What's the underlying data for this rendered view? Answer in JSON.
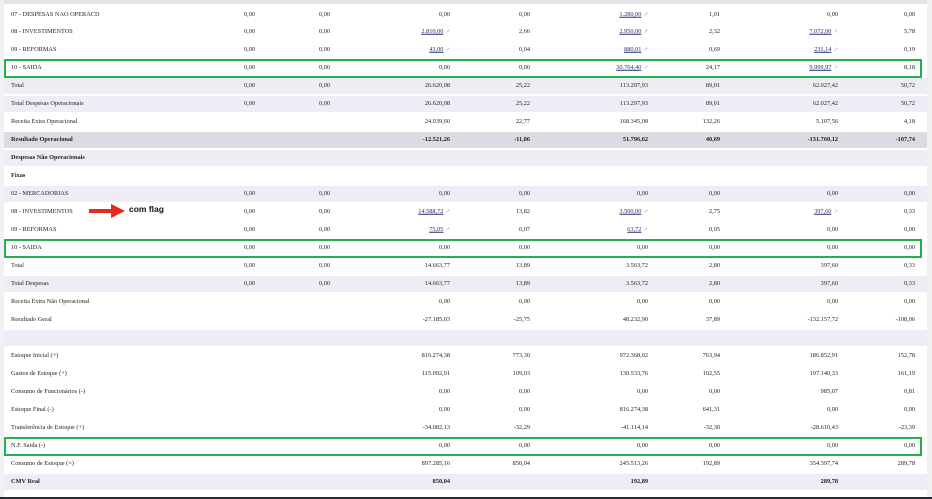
{
  "annotation": {
    "text": "com flag"
  },
  "rows": [
    {
      "label": "07 - DESPESAS NAO OPERACD",
      "c": [
        "0,00",
        "0,00",
        "0,00",
        "0,00",
        "1.280,00",
        "1,01",
        "0,00",
        "0,00"
      ],
      "links": [
        4
      ]
    },
    {
      "label": "08 - INVESTIMENTOS",
      "c": [
        "0,00",
        "0,00",
        "2.810,00",
        "2,66",
        "2.950,00",
        "2,32",
        "7.072,00",
        "5,78"
      ],
      "links": [
        2,
        4,
        6
      ]
    },
    {
      "label": "09 - REFORMAS",
      "c": [
        "0,00",
        "0,00",
        "43,00",
        "0,04",
        "880,01",
        "0,69",
        "231,14",
        "0,19"
      ],
      "links": [
        2,
        4,
        6
      ]
    },
    {
      "label": "10 - SAIDA",
      "c": [
        "0,00",
        "0,00",
        "0,00",
        "0,00",
        "30.764,40",
        "24,17",
        "9.999,97",
        "8,18"
      ],
      "links": [
        4,
        6
      ],
      "highlight": true
    },
    {
      "label": "Total",
      "c": [
        "0,00",
        "0,00",
        "26.620,08",
        "25,22",
        "113.297,93",
        "89,01",
        "62.027,42",
        "50,72"
      ],
      "style": "alt"
    },
    {
      "label": "Total Despesas Operacionais",
      "c": [
        "0,00",
        "0,00",
        "26.620,08",
        "25,22",
        "113.297,93",
        "89,01",
        "62.027,42",
        "50,72"
      ],
      "style": "alt"
    },
    {
      "label": "Receita Extra Operacional",
      "c": [
        "",
        "",
        "24.039,60",
        "22,77",
        "168.345,08",
        "132,26",
        "5.107,56",
        "4,18"
      ]
    },
    {
      "label": "Resultado Operacional",
      "c": [
        "",
        "",
        "-12.521,26",
        "-11,86",
        "51.796,62",
        "40,69",
        "-131.760,12",
        "-107,74"
      ],
      "style": "dark",
      "bold": true
    },
    {
      "label": "Despesas Não Operacionais",
      "c": [],
      "style": "alt",
      "bold": true
    },
    {
      "label": "Fixas",
      "c": [],
      "bold": true
    },
    {
      "label": "02 - MERCADORIAS",
      "c": [
        "0,00",
        "0,00",
        "0,00",
        "0,00",
        "0,00",
        "0,00",
        "0,00",
        "0,00"
      ],
      "style": "alt"
    },
    {
      "label": "08 - INVESTIMENTOS",
      "c": [
        "0,00",
        "0,00",
        "14.588,72",
        "13,82",
        "3.500,00",
        "2,75",
        "397,60",
        "0,33"
      ],
      "links": [
        2,
        4,
        6
      ]
    },
    {
      "label": "09 - REFORMAS",
      "c": [
        "0,00",
        "0,00",
        "75,05",
        "0,07",
        "63,72",
        "0,05",
        "0,00",
        "0,00"
      ],
      "links": [
        2,
        4
      ]
    },
    {
      "label": "10 - SAIDA",
      "c": [
        "0,00",
        "0,00",
        "0,00",
        "0,00",
        "0,00",
        "0,00",
        "0,00",
        "0,00"
      ],
      "highlight": true
    },
    {
      "label": "Total",
      "c": [
        "0,00",
        "0,00",
        "14.663,77",
        "13,89",
        "3.563,72",
        "2,80",
        "397,60",
        "0,33"
      ]
    },
    {
      "label": "Total Despesas",
      "c": [
        "0,00",
        "0,00",
        "14.663,77",
        "13,89",
        "3.563,72",
        "2,80",
        "397,60",
        "0,33"
      ],
      "style": "alt"
    },
    {
      "label": "Receita Extra Não Operacional",
      "c": [
        "",
        "",
        "0,00",
        "0,00",
        "0,00",
        "0,00",
        "0,00",
        "0,00"
      ]
    },
    {
      "label": "Resultado Geral",
      "c": [
        "",
        "",
        "-27.185,03",
        "-25,75",
        "48.232,90",
        "37,89",
        "-132.157,72",
        "-108,06"
      ]
    },
    {
      "label": "",
      "c": [],
      "style": "alt"
    },
    {
      "label": "Estoque Inicial (+)",
      "c": [
        "",
        "",
        "816.274,38",
        "773,30",
        "972.368,02",
        "763,94",
        "186.852,91",
        "152,78"
      ]
    },
    {
      "label": "Gastos de Estoque (+)",
      "c": [
        "",
        "",
        "115.092,91",
        "109,03",
        "130.533,76",
        "102,55",
        "197.140,33",
        "161,19"
      ]
    },
    {
      "label": "Consumo de Funcionários (-)",
      "c": [
        "",
        "",
        "0,00",
        "0,00",
        "0,00",
        "0,00",
        "985,07",
        "0,81"
      ]
    },
    {
      "label": "Estoque Final (-)",
      "c": [
        "",
        "",
        "0,00",
        "0,00",
        "816.274,38",
        "641,31",
        "0,00",
        "0,00"
      ]
    },
    {
      "label": "Transferência de Estoque (+)",
      "c": [
        "",
        "",
        "-34.082,13",
        "-32,29",
        "-41.114,14",
        "-32,30",
        "-28.610,43",
        "-23,39"
      ]
    },
    {
      "label": "N.F. Saida (-)",
      "c": [
        "",
        "",
        "0,00",
        "0,00",
        "0,00",
        "0,00",
        "0,00",
        "0,00"
      ],
      "highlight": true
    },
    {
      "label": "Consumo de Estoque (=)",
      "c": [
        "",
        "",
        "897.285,16",
        "850,04",
        "245.513,26",
        "192,89",
        "354.397,74",
        "289,78"
      ]
    },
    {
      "label": "CMV Real",
      "c": [
        "",
        "",
        "850,04",
        "",
        "192,89",
        "",
        "289,78",
        ""
      ],
      "style": "alt",
      "bold": true
    }
  ]
}
